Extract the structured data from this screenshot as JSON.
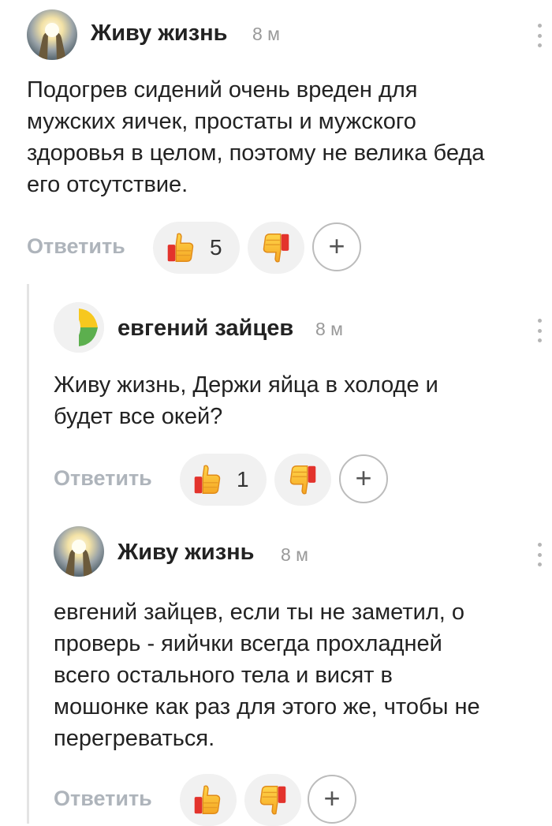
{
  "icons": {
    "like": "thumbs-up-emoji",
    "dislike": "thumbs-down-emoji",
    "add": "plus-icon",
    "more": "vertical-dots-icon"
  },
  "colors": {
    "reply_text": "#aeb4bb",
    "pill_bg": "#f1f1f1",
    "thread_line": "#e4e4e4"
  },
  "comments": [
    {
      "author": "Живу жизнь",
      "time": "8 м",
      "text": "Подогрев сидений очень вреден для\nмужских яичек, простаты и мужского\nздоровья в целом, поэтому не велика беда\nего отсутствие.",
      "reply_label": "Ответить",
      "likes": "5",
      "add_label": "+"
    },
    {
      "author": "евгений зайцев",
      "time": "8 м",
      "text": "Живу жизнь, Держи яйца в холоде и\nбудет все окей?",
      "reply_label": "Ответить",
      "likes": "1",
      "add_label": "+"
    },
    {
      "author": "Живу жизнь",
      "time": "8 м",
      "text": "евгений зайцев, если ты не заметил, о\nпроверь - яийчки всегда прохладней\nвсего остального тела и висят в\nмошонке как раз для этого же, чтобы не\nперегреваться.",
      "reply_label": "Ответить",
      "likes": "",
      "add_label": "+"
    }
  ]
}
